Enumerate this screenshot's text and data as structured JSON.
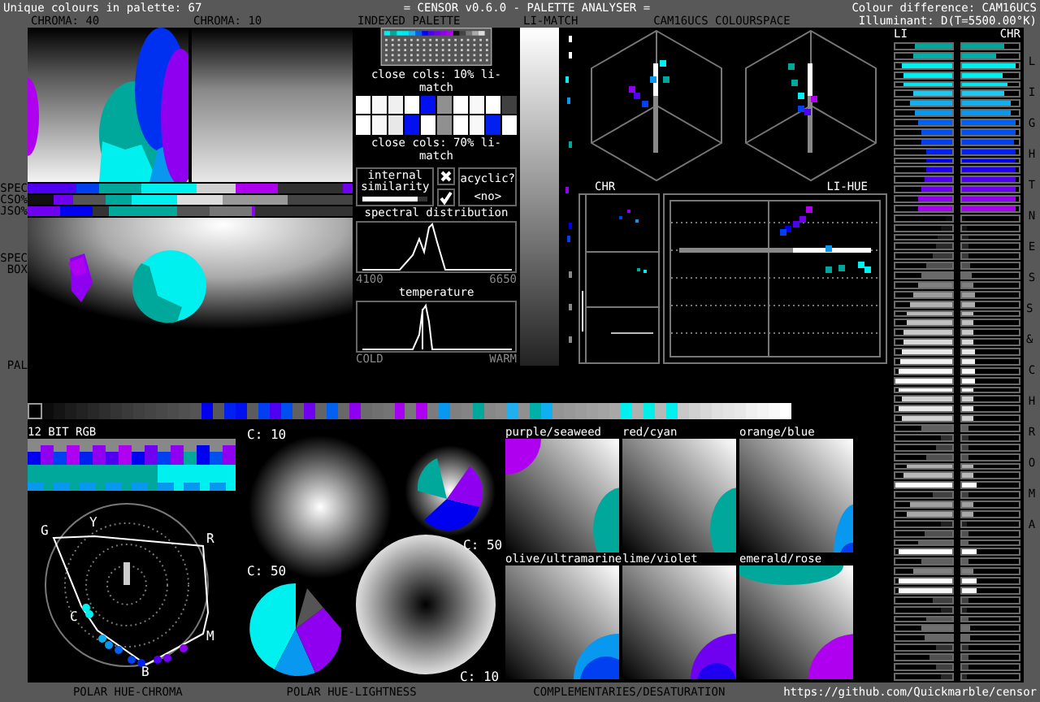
{
  "header": {
    "unique_colours": "Unique colours in palette: 67",
    "title": "= CENSOR v0.6.0 - PALETTE ANALYSER =",
    "colour_difference": "Colour difference: CAM16UCS",
    "illuminant": "Illuminant: D(T=5500.00°K)"
  },
  "panel_labels": {
    "chroma_40": "CHROMA: 40",
    "chroma_10": "CHROMA: 10",
    "indexed_palette": "INDEXED PALETTE",
    "li_match": "LI-MATCH",
    "colourspace": "CAM16UCS COLOURSPACE"
  },
  "side_labels": {
    "spec": "SPEC",
    "cso": "CSO%",
    "jso": "JSO%",
    "spec_box": "SPEC BOX",
    "pal": "PAL"
  },
  "close_cols": {
    "labels": [
      "close cols: 10% li-match",
      "close cols: 70% li-match"
    ],
    "rows": [
      [
        {
          "color": "#ffffff"
        },
        {
          "color": "#f8f8f8"
        },
        {
          "color": "#f0f0f0"
        },
        {
          "color": "#ffffff"
        },
        {
          "color": "#0010f0"
        },
        {
          "color": "#909090"
        },
        {
          "color": "#ffffff"
        },
        {
          "color": "#f8f8f8"
        },
        {
          "color": "#ffffff"
        },
        {
          "color": "#404040"
        }
      ],
      [
        {
          "color": "#ffffff"
        },
        {
          "color": "#f8f8f8"
        },
        {
          "color": "#e8e8e8"
        },
        {
          "color": "#0010f0"
        },
        {
          "color": "#ffffff"
        },
        {
          "color": "#909090"
        },
        {
          "color": "#ffffff"
        },
        {
          "color": "#f8f8f8"
        },
        {
          "color": "#0020f0"
        },
        {
          "color": "#ffffff"
        }
      ]
    ]
  },
  "similarity": {
    "label": "internal similarity",
    "level": 0.85
  },
  "acyclic": {
    "label": "acyclic?",
    "value": "<no>"
  },
  "spectral": {
    "title": "spectral distribution",
    "min": "4100",
    "max": "6650"
  },
  "temperature": {
    "title": "temperature",
    "min": "COLD",
    "max": "WARM"
  },
  "plots": {
    "chr": "CHR",
    "li_hue": "LI-HUE"
  },
  "bars": {
    "li": "LI",
    "chr": "CHR",
    "side_title": "LIGHTNESS & CHROMA",
    "rows": [
      {
        "color": "#00a89c",
        "li": {
          "level": 0.65
        },
        "chr": {
          "level": 0.75
        }
      },
      {
        "color": "#00b0a8",
        "li": {
          "level": 0.7
        },
        "chr": {
          "level": 0.6
        }
      },
      {
        "color": "#00f0f0",
        "li": {
          "level": 0.88
        },
        "chr": {
          "level": 0.95
        }
      },
      {
        "color": "#00f0f0",
        "li": {
          "level": 0.85
        },
        "chr": {
          "level": 0.7
        }
      },
      {
        "color": "#00e8f0",
        "li": {
          "level": 0.85
        },
        "chr": {
          "level": 0.8
        }
      },
      {
        "color": "#20c8f0",
        "li": {
          "level": 0.7
        },
        "chr": {
          "level": 0.75
        }
      },
      {
        "color": "#10b0f0",
        "li": {
          "level": 0.75
        },
        "chr": {
          "level": 0.85
        }
      },
      {
        "color": "#0898f0",
        "li": {
          "level": 0.65
        },
        "chr": {
          "level": 0.85
        }
      },
      {
        "color": "#0060f0",
        "li": {
          "level": 0.6
        },
        "chr": {
          "level": 0.95
        }
      },
      {
        "color": "#0050f0",
        "li": {
          "level": 0.55
        },
        "chr": {
          "level": 0.95
        }
      },
      {
        "color": "#0040f0",
        "li": {
          "level": 0.55
        },
        "chr": {
          "level": 0.9
        }
      },
      {
        "color": "#0020f0",
        "li": {
          "level": 0.45
        },
        "chr": {
          "level": 0.95
        }
      },
      {
        "color": "#0000f0",
        "li": {
          "level": 0.45
        },
        "chr": {
          "level": 0.95
        }
      },
      {
        "color": "#2000f0",
        "li": {
          "level": 0.45
        },
        "chr": {
          "level": 0.95
        }
      },
      {
        "color": "#5000f0",
        "li": {
          "level": 0.5
        },
        "chr": {
          "level": 0.95
        }
      },
      {
        "color": "#7000f0",
        "li": {
          "level": 0.55
        },
        "chr": {
          "level": 0.95
        }
      },
      {
        "color": "#9000f0",
        "li": {
          "level": 0.6
        },
        "chr": {
          "level": 0.95
        }
      },
      {
        "color": "#a800f0",
        "li": {
          "level": 0.6
        },
        "chr": {
          "level": 0.95
        }
      },
      {
        "color": "#0a0a0a",
        "li": {
          "level": 0.12
        },
        "chr": {
          "level": 0.05
        }
      },
      {
        "color": "#141414",
        "li": {
          "level": 0.2
        },
        "chr": {
          "level": 0.08
        }
      },
      {
        "color": "#1e1e1e",
        "li": {
          "level": 0.25
        },
        "chr": {
          "level": 0.1
        }
      },
      {
        "color": "#282828",
        "li": {
          "level": 0.3
        },
        "chr": {
          "level": 0.1
        }
      },
      {
        "color": "#3a3a3a",
        "li": {
          "level": 0.35
        },
        "chr": {
          "level": 0.12
        }
      },
      {
        "color": "#505050",
        "li": {
          "level": 0.45
        },
        "chr": {
          "level": 0.15
        }
      },
      {
        "color": "#6a6a6a",
        "li": {
          "level": 0.55
        },
        "chr": {
          "level": 0.18
        }
      },
      {
        "color": "#808080",
        "li": {
          "level": 0.6
        },
        "chr": {
          "level": 0.2
        }
      },
      {
        "color": "#9a9a9a",
        "li": {
          "level": 0.7
        },
        "chr": {
          "level": 0.22
        }
      },
      {
        "color": "#b0b0b0",
        "li": {
          "level": 0.75
        },
        "chr": {
          "level": 0.22
        }
      },
      {
        "color": "#b8b8b8",
        "li": {
          "level": 0.8
        },
        "chr": {
          "level": 0.2
        }
      },
      {
        "color": "#c0c0c0",
        "li": {
          "level": 0.8
        },
        "chr": {
          "level": 0.2
        }
      },
      {
        "color": "#c8c8c8",
        "li": {
          "level": 0.85
        },
        "chr": {
          "level": 0.2
        }
      },
      {
        "color": "#d8d8d8",
        "li": {
          "level": 0.85
        },
        "chr": {
          "level": 0.2
        }
      },
      {
        "color": "#e8e8e8",
        "li": {
          "level": 0.9
        },
        "chr": {
          "level": 0.22
        }
      },
      {
        "color": "#f0f0f0",
        "li": {
          "level": 0.92
        },
        "chr": {
          "level": 0.22
        }
      },
      {
        "color": "#f8f8f8",
        "li": {
          "level": 0.95
        },
        "chr": {
          "level": 0.22
        }
      },
      {
        "color": "#ffffff",
        "li": {
          "level": 1
        },
        "chr": {
          "level": 0.22
        }
      },
      {
        "color": "#f4f4f4",
        "li": {
          "level": 0.95
        },
        "chr": {
          "level": 0.2
        }
      },
      {
        "color": "#d0d0d0",
        "li": {
          "level": 0.9
        },
        "chr": {
          "level": 0.2
        }
      },
      {
        "color": "#e8e8e8",
        "li": {
          "level": 0.95
        },
        "chr": {
          "level": 0.2
        }
      },
      {
        "color": "#d0d0d0",
        "li": {
          "level": 0.9
        },
        "chr": {
          "level": 0.2
        }
      },
      {
        "color": "#606060",
        "li": {
          "level": 0.55
        },
        "chr": {
          "level": 0.12
        }
      },
      {
        "color": "#303030",
        "li": {
          "level": 0.2
        },
        "chr": {
          "level": 0.1
        }
      },
      {
        "color": "#404040",
        "li": {
          "level": 0.3
        },
        "chr": {
          "level": 0.1
        }
      },
      {
        "color": "#505050",
        "li": {
          "level": 0.45
        },
        "chr": {
          "level": 0.12
        }
      },
      {
        "color": "#b0b0b0",
        "li": {
          "level": 0.8
        },
        "chr": {
          "level": 0.2
        }
      },
      {
        "color": "#b8b8b8",
        "li": {
          "level": 0.85
        },
        "chr": {
          "level": 0.2
        }
      },
      {
        "color": "#ffffff",
        "li": {
          "level": 1
        },
        "chr": {
          "level": 0.25
        }
      },
      {
        "color": "#404040",
        "li": {
          "level": 0.35
        },
        "chr": {
          "level": 0.1
        }
      },
      {
        "color": "#a0a0a0",
        "li": {
          "level": 0.75
        },
        "chr": {
          "level": 0.2
        }
      },
      {
        "color": "#a8a8a8",
        "li": {
          "level": 0.8
        },
        "chr": {
          "level": 0.2
        }
      },
      {
        "color": "#202020",
        "li": {
          "level": 0.2
        },
        "chr": {
          "level": 0.08
        }
      },
      {
        "color": "#505050",
        "li": {
          "level": 0.5
        },
        "chr": {
          "level": 0.12
        }
      },
      {
        "color": "#606060",
        "li": {
          "level": 0.6
        },
        "chr": {
          "level": 0.12
        }
      },
      {
        "color": "#ffffff",
        "li": {
          "level": 0.95
        },
        "chr": {
          "level": 0.25
        }
      },
      {
        "color": "#606060",
        "li": {
          "level": 0.55
        },
        "chr": {
          "level": 0.12
        }
      },
      {
        "color": "#808080",
        "li": {
          "level": 0.7
        },
        "chr": {
          "level": 0.2
        }
      },
      {
        "color": "#ffffff",
        "li": {
          "level": 0.95
        },
        "chr": {
          "level": 0.25
        }
      },
      {
        "color": "#f8f8f8",
        "li": {
          "level": 0.95
        },
        "chr": {
          "level": 0.25
        }
      },
      {
        "color": "#404040",
        "li": {
          "level": 0.35
        },
        "chr": {
          "level": 0.1
        }
      },
      {
        "color": "#202020",
        "li": {
          "level": 0.2
        },
        "chr": {
          "level": 0.08
        }
      },
      {
        "color": "#585858",
        "li": {
          "level": 0.45
        },
        "chr": {
          "level": 0.12
        }
      },
      {
        "color": "#707070",
        "li": {
          "level": 0.55
        },
        "chr": {
          "level": 0.15
        }
      },
      {
        "color": "#686868",
        "li": {
          "level": 0.5
        },
        "chr": {
          "level": 0.15
        }
      },
      {
        "color": "#303030",
        "li": {
          "level": 0.3
        },
        "chr": {
          "level": 0.1
        }
      },
      {
        "color": "#505050",
        "li": {
          "level": 0.4
        },
        "chr": {
          "level": 0.12
        }
      },
      {
        "color": "#404040",
        "li": {
          "level": 0.3
        },
        "chr": {
          "level": 0.1
        }
      },
      {
        "color": "#282828",
        "li": {
          "level": 0.2
        },
        "chr": {
          "level": 0.08
        }
      }
    ]
  },
  "palette": [
    {
      "color": "#000000"
    },
    {
      "color": "#0c0c0c"
    },
    {
      "color": "#141414"
    },
    {
      "color": "#1c1c1c"
    },
    {
      "color": "#222222"
    },
    {
      "color": "#282828"
    },
    {
      "color": "#2e2e2e"
    },
    {
      "color": "#343434"
    },
    {
      "color": "#3a3a3a"
    },
    {
      "color": "#404040"
    },
    {
      "color": "#444444"
    },
    {
      "color": "#484848"
    },
    {
      "color": "#4c4c4c"
    },
    {
      "color": "#505050"
    },
    {
      "color": "#545454"
    },
    {
      "color": "#0000f0"
    },
    {
      "color": "#585858"
    },
    {
      "color": "#0020f0"
    },
    {
      "color": "#0010f0"
    },
    {
      "color": "#5c5c5c"
    },
    {
      "color": "#0040f0"
    },
    {
      "color": "#5000f0"
    },
    {
      "color": "#0050f0"
    },
    {
      "color": "#606060"
    },
    {
      "color": "#7000f0"
    },
    {
      "color": "#646464"
    },
    {
      "color": "#0060f0"
    },
    {
      "color": "#686868"
    },
    {
      "color": "#9000f0"
    },
    {
      "color": "#6c6c6c"
    },
    {
      "color": "#707070"
    },
    {
      "color": "#747474"
    },
    {
      "color": "#a800f0"
    },
    {
      "color": "#787878"
    },
    {
      "color": "#b000f0"
    },
    {
      "color": "#7c7c7c"
    },
    {
      "color": "#0898f0"
    },
    {
      "color": "#808080"
    },
    {
      "color": "#848484"
    },
    {
      "color": "#00a89c"
    },
    {
      "color": "#888888"
    },
    {
      "color": "#8c8c8c"
    },
    {
      "color": "#20b0f0"
    },
    {
      "color": "#909090"
    },
    {
      "color": "#00b0a8"
    },
    {
      "color": "#10b0f0"
    },
    {
      "color": "#949494"
    },
    {
      "color": "#989898"
    },
    {
      "color": "#9c9c9c"
    },
    {
      "color": "#a0a0a0"
    },
    {
      "color": "#a4a4a4"
    },
    {
      "color": "#a8a8a8"
    },
    {
      "color": "#00f0f0"
    },
    {
      "color": "#b0b0b0"
    },
    {
      "color": "#00f0e8"
    },
    {
      "color": "#b8b8b8"
    },
    {
      "color": "#00f0f0"
    },
    {
      "color": "#c8c8c8"
    },
    {
      "color": "#d0d0d0"
    },
    {
      "color": "#d8d8d8"
    },
    {
      "color": "#e0e0e0"
    },
    {
      "color": "#e4e4e4"
    },
    {
      "color": "#e8e8e8"
    },
    {
      "color": "#f0f0f0"
    },
    {
      "color": "#f4f4f4"
    },
    {
      "color": "#f8f8f8"
    },
    {
      "color": "#ffffff"
    }
  ],
  "rgb_title": "12 BIT RGB",
  "hue_chroma": {
    "labels": [
      "G",
      "Y",
      "R",
      "C",
      "M",
      "B"
    ],
    "title": "POLAR HUE-CHROMA"
  },
  "hue_lightness": {
    "discs": [
      {
        "label": "C: 10"
      },
      {
        "label": "C: 50"
      },
      {
        "label": "C: 50"
      },
      {
        "label": "C: 10"
      }
    ],
    "title": "POLAR HUE-LIGHTNESS"
  },
  "complementaries": {
    "tiles": [
      {
        "label": "purple/seaweed"
      },
      {
        "label": "red/cyan"
      },
      {
        "label": "orange/blue"
      },
      {
        "label": "olive/ultramarine"
      },
      {
        "label": "lime/violet"
      },
      {
        "label": "emerald/rose"
      }
    ],
    "title": "COMPLEMENTARIES/DESATURATION"
  },
  "link": "https://github.com/Quickmarble/censor"
}
